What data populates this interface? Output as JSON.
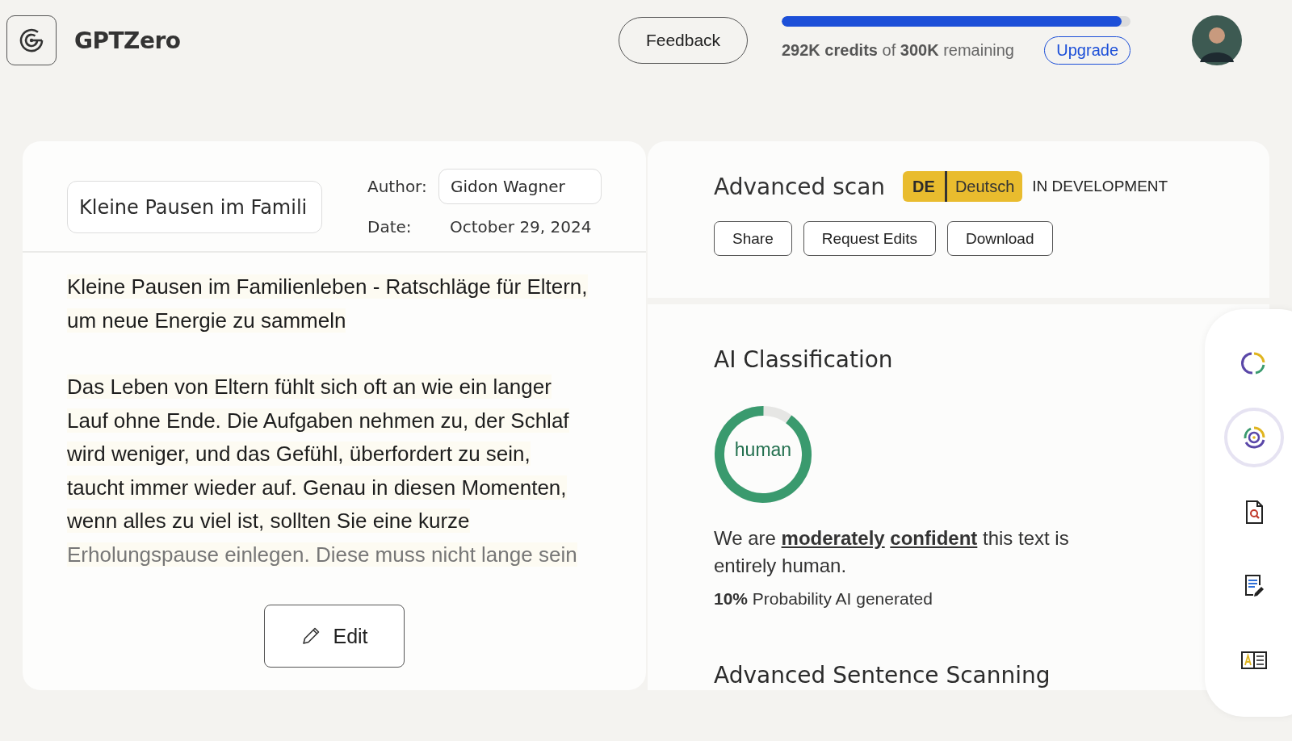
{
  "header": {
    "app_name": "GPTZero",
    "feedback_button": "Feedback",
    "credits": {
      "level": 0.975,
      "text": "**292K credits** of **300K** remaining"
    },
    "upgrade_button": "Upgrade"
  },
  "document": {
    "title_value": "Kleine Pausen im Famili",
    "author_label": "Author:",
    "author_value": "Gidon Wagner",
    "date_label": "Date:",
    "date_value": "October 29, 2024",
    "paragraphs": [
      {
        "lines": [
          "Kleine Pausen im Familienleben - Ratschläge für Eltern,",
          "um neue Energie zu sammeln"
        ]
      },
      {
        "lines": [
          "Das Leben von Eltern fühlt sich oft an wie ein langer",
          "Lauf ohne Ende. Die Aufgaben nehmen zu, der Schlaf",
          "wird weniger, und das Gefühl, überfordert zu sein,",
          "taucht immer wieder auf. Genau in diesen Momenten,",
          "wenn alles zu viel ist, sollten Sie eine kurze",
          "Erholungspause einlegen. Diese muss nicht lange sein"
        ]
      }
    ],
    "edit_button": "Edit"
  },
  "scan": {
    "title": "Advanced scan",
    "language_code": "DE",
    "language_name": "Deutsch",
    "status": "IN DEVELOPMENT",
    "buttons": [
      "Share",
      "Request Edits",
      "Download"
    ]
  },
  "classification": {
    "heading": "AI Classification",
    "label": "human",
    "level": 0.9,
    "sentence": [
      {
        "kind": "plain",
        "text": "We are "
      },
      {
        "kind": "link",
        "text": "moderately"
      },
      {
        "kind": "link",
        "text": "confident"
      },
      {
        "kind": "plain",
        "text": " this text is entirely human."
      }
    ],
    "probability": "**10%** Probability AI generated",
    "next_heading": "Advanced Sentence Scanning"
  },
  "side_tools": [
    {
      "kind": "ring",
      "selected": false
    },
    {
      "kind": "target",
      "selected": true
    },
    {
      "kind": "search-doc",
      "selected": false
    },
    {
      "kind": "edit-doc",
      "selected": false
    },
    {
      "kind": "translate",
      "selected": false
    }
  ]
}
